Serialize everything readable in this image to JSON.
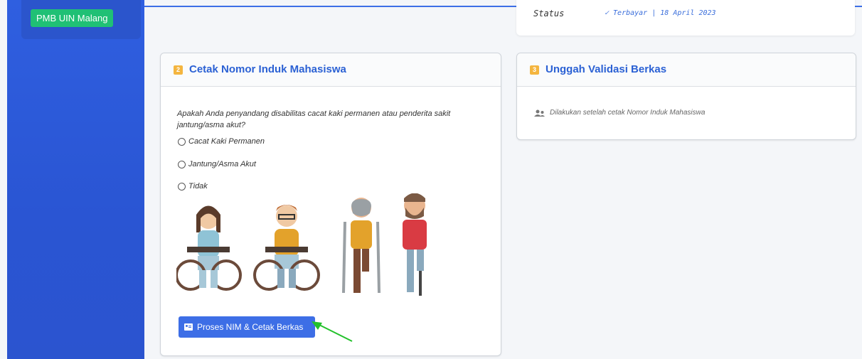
{
  "sidebar": {
    "brand": "PMB UIN Malang"
  },
  "status_card": {
    "label": "Status",
    "value": "✓ Terbayar | 18 April 2023"
  },
  "card2": {
    "number": "2",
    "title": "Cetak Nomor Induk Mahasiswa",
    "question": "Apakah Anda penyandang disabilitas cacat kaki permanen atau penderita sakit jantung/asma akut?",
    "options": [
      "Cacat Kaki Permanen",
      "Jantung/Asma Akut",
      "Tidak"
    ],
    "button_label": "Proses NIM & Cetak Berkas"
  },
  "card3": {
    "number": "3",
    "title": "Unggah Validasi Berkas",
    "info": "Dilakukan setelah cetak Nomor Induk Mahasiswa"
  },
  "colors": {
    "primary": "#3d6ee6",
    "accent": "#20c075",
    "badge": "#f4b53f",
    "arrow": "#22c12a"
  },
  "icons": [
    "id-card-icon",
    "users-icon",
    "green-arrow-icon"
  ]
}
